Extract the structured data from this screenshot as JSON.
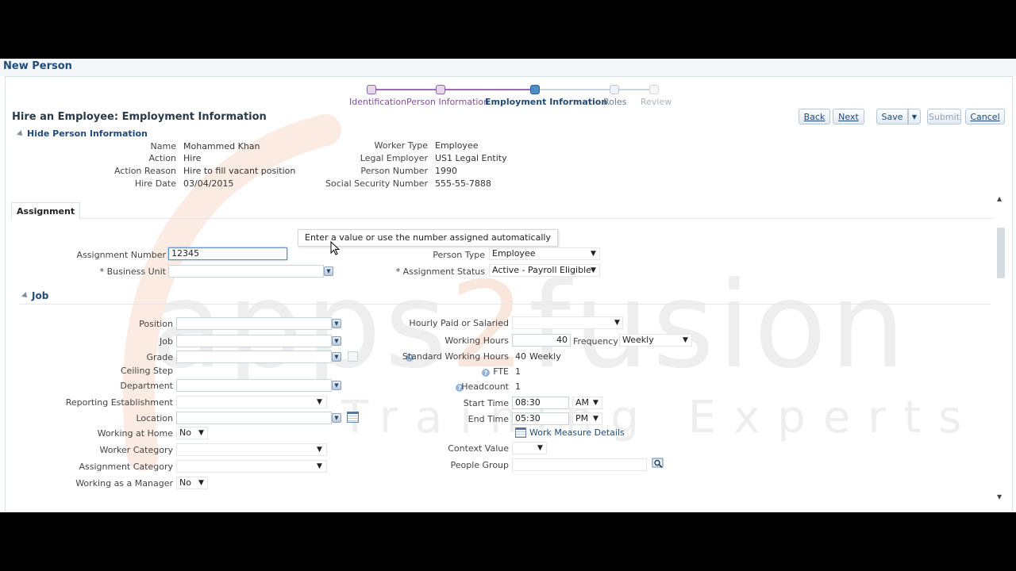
{
  "page_title": "New Person",
  "train": [
    {
      "label": "Identification",
      "state": "visited"
    },
    {
      "label": "Person Information",
      "state": "visited"
    },
    {
      "label": "Employment Information",
      "state": "current"
    },
    {
      "label": "Roles",
      "state": "future"
    },
    {
      "label": "Review",
      "state": "disabled"
    }
  ],
  "section_title": "Hire an Employee: Employment Information",
  "toolbar": {
    "back": "Back",
    "next": "Next",
    "save": "Save",
    "submit": "Submit",
    "cancel": "Cancel"
  },
  "person_info": {
    "toggle_label": "Hide Person Information",
    "left": [
      {
        "label": "Name",
        "value": "Mohammed Khan"
      },
      {
        "label": "Action",
        "value": "Hire"
      },
      {
        "label": "Action Reason",
        "value": "Hire to fill vacant position"
      },
      {
        "label": "Hire Date",
        "value": "03/04/2015"
      }
    ],
    "right": [
      {
        "label": "Worker Type",
        "value": "Employee"
      },
      {
        "label": "Legal Employer",
        "value": "US1 Legal Entity"
      },
      {
        "label": "Person Number",
        "value": "1990"
      },
      {
        "label": "Social Security Number",
        "value": "555-55-7888"
      }
    ]
  },
  "assignment": {
    "tab_label": "Assignment",
    "tooltip": "Enter a value or use the number assigned automatically",
    "assignment_number_label": "Assignment Number",
    "assignment_number_value": "12345",
    "business_unit_label": "* Business Unit",
    "business_unit_value": "",
    "person_type_label": "Person Type",
    "person_type_value": "Employee",
    "assignment_status_label": "* Assignment Status",
    "assignment_status_value": "Active - Payroll Eligible"
  },
  "job": {
    "toggle_label": "Job",
    "position_label": "Position",
    "job_label": "Job",
    "grade_label": "Grade",
    "ceiling_step_label": "Ceiling Step",
    "department_label": "Department",
    "reporting_establishment_label": "Reporting Establishment",
    "location_label": "Location",
    "working_at_home_label": "Working at Home",
    "working_at_home_value": "No",
    "worker_category_label": "Worker Category",
    "assignment_category_label": "Assignment Category",
    "working_as_manager_label": "Working as a Manager",
    "working_as_manager_value": "No",
    "hourly_paid_label": "Hourly Paid or Salaried",
    "working_hours_label": "Working Hours",
    "working_hours_value": "40",
    "frequency_label": "Frequency",
    "frequency_value": "Weekly",
    "standard_hours_label": "Standard Working Hours",
    "standard_hours_value": "40",
    "standard_hours_unit": "Weekly",
    "fte_label": "FTE",
    "fte_value": "1",
    "headcount_label": "Headcount",
    "headcount_value": "1",
    "start_time_label": "Start Time",
    "start_time_value": "08:30",
    "start_time_ampm": "AM",
    "end_time_label": "End Time",
    "end_time_value": "05:30",
    "end_time_ampm": "PM",
    "work_measure_link": "Work Measure Details",
    "context_value_label": "Context Value",
    "people_group_label": "People Group"
  },
  "watermark": {
    "brand_prefix": "apps",
    "brand_number": "2",
    "brand_suffix": "fusion",
    "tagline": "Training Experts"
  },
  "colors": {
    "title_blue": "#1f4a7a",
    "train_visited": "#9b6fb5",
    "train_current": "#4e8cc7",
    "watermark_accent": "#f7ddd0"
  }
}
